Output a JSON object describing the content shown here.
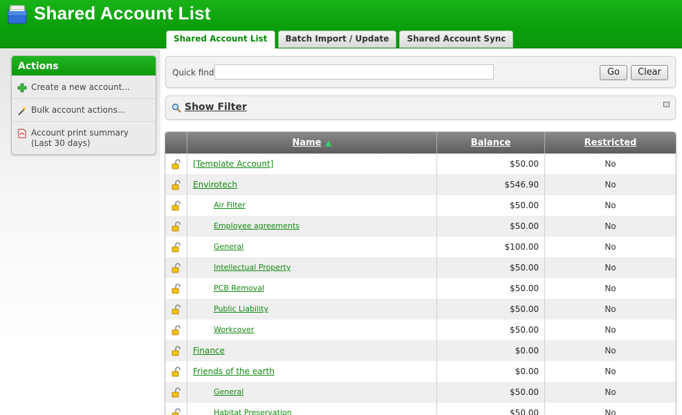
{
  "header": {
    "title": "Shared Account List",
    "tabs": [
      "Shared Account List",
      "Batch Import / Update",
      "Shared Account Sync"
    ]
  },
  "actions": {
    "title": "Actions",
    "items": [
      {
        "label": "Create a new account...",
        "icon": "add-icon"
      },
      {
        "label": "Bulk account actions...",
        "icon": "wand-icon"
      },
      {
        "label": "Account print summary (Last 30 days)",
        "icon": "pdf-icon"
      }
    ]
  },
  "quickfind": {
    "label": "Quick find:",
    "value": "",
    "go": "Go",
    "clear": "Clear"
  },
  "filter": {
    "label": "Show Filter"
  },
  "table": {
    "columns": [
      "Name",
      "Balance",
      "Restricted"
    ],
    "rows": [
      {
        "name": "[Template Account]",
        "balance": "$50.00",
        "restricted": "No",
        "sub": false
      },
      {
        "name": "Envirotech",
        "balance": "$546.90",
        "restricted": "No",
        "sub": false
      },
      {
        "name": "Air Filter",
        "balance": "$50.00",
        "restricted": "No",
        "sub": true
      },
      {
        "name": "Employee agreements",
        "balance": "$50.00",
        "restricted": "No",
        "sub": true
      },
      {
        "name": "General",
        "balance": "$100.00",
        "restricted": "No",
        "sub": true
      },
      {
        "name": "Intellectual Property",
        "balance": "$50.00",
        "restricted": "No",
        "sub": true
      },
      {
        "name": "PCB Removal",
        "balance": "$50.00",
        "restricted": "No",
        "sub": true
      },
      {
        "name": "Public Liability",
        "balance": "$50.00",
        "restricted": "No",
        "sub": true
      },
      {
        "name": "Workcover",
        "balance": "$50.00",
        "restricted": "No",
        "sub": true
      },
      {
        "name": "Finance",
        "balance": "$0.00",
        "restricted": "No",
        "sub": false
      },
      {
        "name": "Friends of the earth",
        "balance": "$0.00",
        "restricted": "No",
        "sub": false
      },
      {
        "name": "General",
        "balance": "$50.00",
        "restricted": "No",
        "sub": true
      },
      {
        "name": "Habitat Preservation",
        "balance": "$50.00",
        "restricted": "No",
        "sub": true
      }
    ]
  },
  "colors": {
    "brand_green": "#0a9e0a",
    "link_green": "#118811"
  }
}
